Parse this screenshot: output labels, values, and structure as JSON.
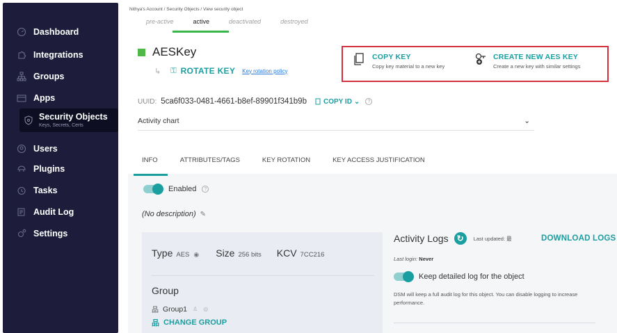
{
  "sidebar": {
    "items": [
      {
        "label": "Dashboard",
        "icon": "gauge-icon"
      },
      {
        "label": "Integrations",
        "icon": "puzzle-icon"
      },
      {
        "label": "Groups",
        "icon": "hierarchy-icon"
      },
      {
        "label": "Apps",
        "icon": "app-window-icon"
      },
      {
        "label": "Security Objects",
        "sub": "Keys, Secrets, Certs",
        "icon": "shield-icon",
        "active": true
      },
      {
        "label": "Users",
        "icon": "user-icon"
      },
      {
        "label": "Plugins",
        "icon": "plugin-icon"
      },
      {
        "label": "Tasks",
        "icon": "clock-icon"
      },
      {
        "label": "Audit Log",
        "icon": "audit-icon"
      },
      {
        "label": "Settings",
        "icon": "gear-icon"
      }
    ]
  },
  "breadcrumb": "Nithya's Account / Security Objects / View security object",
  "state_tabs": [
    "pre-active",
    "active",
    "deactivated",
    "destroyed"
  ],
  "object": {
    "name": "AESKey",
    "rotate_label": "ROTATE KEY",
    "policy_link": "Key rotation policy",
    "uuid_label": "UUID:",
    "uuid": "5ca6f033-0481-4661-b8ef-89901f341b9b",
    "copy_id": "COPY ID",
    "activity_chart": "Activity chart"
  },
  "actions": {
    "copy_key": {
      "title": "COPY KEY",
      "desc": "Copy key material to a new key"
    },
    "create_key": {
      "title": "CREATE NEW AES KEY",
      "desc": "Create a new key with similar settings"
    }
  },
  "panel_tabs": [
    "INFO",
    "ATTRIBUTES/TAGS",
    "KEY ROTATION",
    "KEY ACCESS JUSTIFICATION"
  ],
  "info": {
    "enabled_label": "Enabled",
    "description": "(No description)",
    "type_label": "Type",
    "type_value": "AES",
    "size_label": "Size",
    "size_value": "256 bits",
    "kcv_label": "KCV",
    "kcv_value": "7CC216",
    "group_title": "Group",
    "group_name": "Group1",
    "change_group": "CHANGE GROUP"
  },
  "logs": {
    "title": "Activity Logs",
    "last_updated": "Last updated: 最",
    "download": "DOWNLOAD LOGS",
    "last_login_label": "Last login:",
    "last_login_value": "Never",
    "keep_label": "Keep detailed log for the object",
    "note": "DSM will keep a full audit log for this object. You can disable logging to increase performance."
  },
  "colors": {
    "sidebar_bg": "#1d1d3b",
    "accent": "#1a9ea0",
    "highlight_border": "#d62f3c",
    "active_green": "#3ab54a"
  }
}
